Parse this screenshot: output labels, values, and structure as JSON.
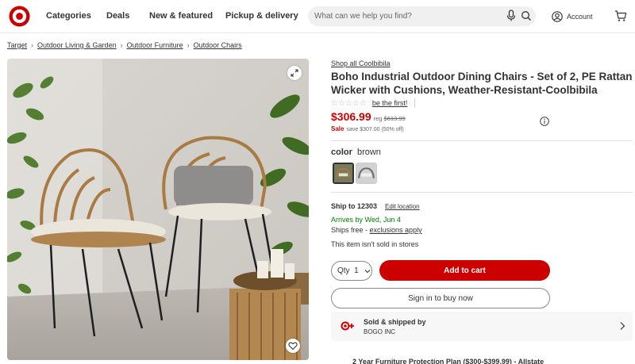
{
  "header": {
    "nav": [
      "Categories",
      "Deals",
      "New & featured",
      "Pickup & delivery"
    ],
    "search_placeholder": "What can we help you find?",
    "account_label": "Account",
    "brand_color": "#cc0000"
  },
  "breadcrumb": [
    "Target",
    "Outdoor Living & Garden",
    "Outdoor Furniture",
    "Outdoor Chairs"
  ],
  "product": {
    "shop_all": "Shop all Coolbibila",
    "title": "Boho Industrial Outdoor Dining Chairs - Set of 2, PE Rattan Wicker with Cushions, Weather-Resistant-Coolbibila",
    "stars": "☆☆☆☆☆",
    "rating_link": "be the first!",
    "price": "$306.99",
    "reg_label": "reg",
    "reg_price": "$613.99",
    "sale_label": "Sale",
    "savings": "save $307.00 (50% off)",
    "color_label": "color",
    "color_value": "brown",
    "rating_value": 0
  },
  "fulfillment": {
    "ship_to": "Ship to 12303",
    "edit_location": "Edit location",
    "arrives": "Arrives by Wed, Jun 4",
    "ships_free": "Ships free - ",
    "exclusions": "exclusions apply",
    "not_sold": "This item isn't sold in stores"
  },
  "actions": {
    "qty_label": "Qty",
    "qty_value": "1",
    "add_to_cart": "Add to cart",
    "sign_in": "Sign in to buy now"
  },
  "seller": {
    "title": "Sold & shipped by",
    "name": "BOGO INC"
  },
  "protection_plan": "2 Year Furniture Protection Plan ($300-$399.99) - Allstate"
}
